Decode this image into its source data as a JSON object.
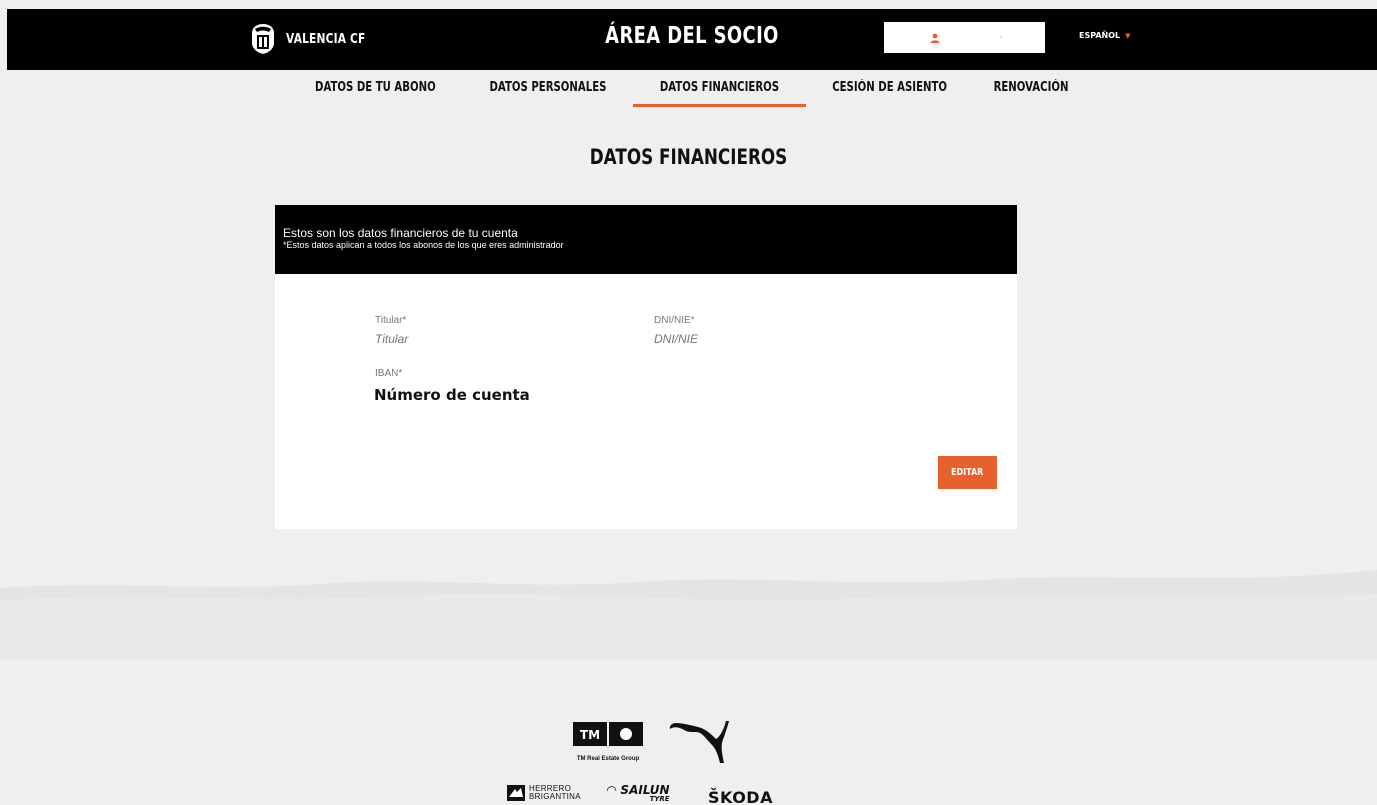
{
  "header": {
    "brand_name": "VALENCIA CF",
    "title": "ÁREA DEL SOCIO",
    "user_icon": "user-icon",
    "language": "ESPAÑOL",
    "accent_color": "#e8612c"
  },
  "tabs": [
    {
      "label": "DATOS DE TU ABONO",
      "active": false
    },
    {
      "label": "DATOS PERSONALES",
      "active": false
    },
    {
      "label": "DATOS FINANCIEROS",
      "active": true
    },
    {
      "label": "CESIÓN DE ASIENTO",
      "active": false
    },
    {
      "label": "RENOVACIÓN",
      "active": false
    }
  ],
  "page_title": "DATOS FINANCIEROS",
  "card": {
    "heading": "Estos son los datos financieros de tu cuenta",
    "subheading": "*Estos datos aplican a todos los abonos de los que eres administrador",
    "titular": {
      "label": "Titular*",
      "placeholder": "Titular"
    },
    "dni": {
      "label": "DNI/NIE*",
      "placeholder": "DNI/NIE"
    },
    "iban": {
      "label": "IBAN*",
      "value": "Número de cuenta"
    },
    "edit_button": "EDITAR"
  },
  "sponsors": {
    "tm_caption": "TM Real Estate Group",
    "herrero_line1": "HERRERO",
    "herrero_line2": "BRIGANTINA",
    "sailun": "SAILUN",
    "sailun_sub": "TYRE",
    "skoda": "ŠKODA"
  }
}
